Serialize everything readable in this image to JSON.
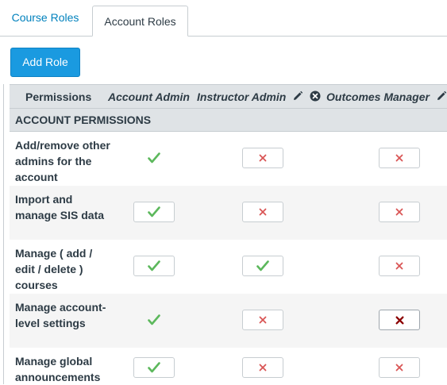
{
  "tabs": [
    {
      "label": "Course Roles",
      "active": false
    },
    {
      "label": "Account Roles",
      "active": true
    }
  ],
  "add_role_button": "Add Role",
  "table": {
    "header": {
      "permissions": "Permissions",
      "roles": [
        "Account Admin",
        "Instructor Admin",
        "Outcomes Manager"
      ]
    },
    "section": "ACCOUNT PERMISSIONS",
    "rows": [
      {
        "label": "Add/remove other admins for the account",
        "cells": [
          "check",
          "x",
          "x"
        ]
      },
      {
        "label": "Import and manage SIS data",
        "cells": [
          "check",
          "x",
          "x"
        ]
      },
      {
        "label": "Manage ( add / edit / delete ) courses",
        "cells": [
          "check",
          "check",
          "x"
        ]
      },
      {
        "label": "Manage account-level settings",
        "cells": [
          "check",
          "x",
          "x-dark"
        ]
      },
      {
        "label": "Manage global announcements",
        "cells": [
          "check",
          "x",
          "x"
        ]
      }
    ]
  },
  "icons": {
    "edit": "pencil-icon",
    "remove": "remove-circle-icon",
    "enabled": "checkmark-icon",
    "disabled": "x-icon"
  },
  "colors": {
    "primary": "#1a9ae0",
    "tab_link": "#0081bd",
    "check": "#5cb85c",
    "x": "#d95555",
    "x_dark": "#8b0000"
  }
}
